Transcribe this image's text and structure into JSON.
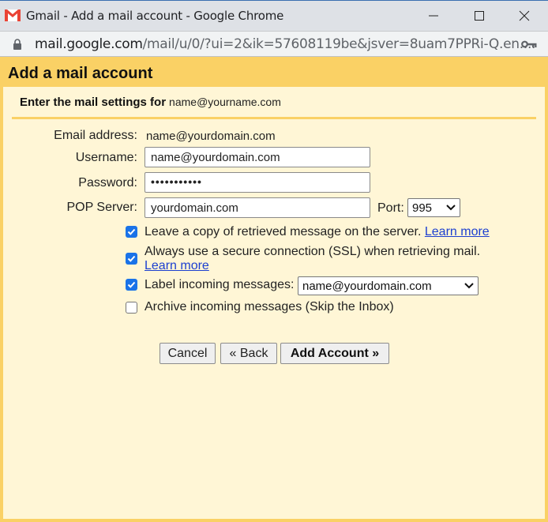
{
  "window": {
    "title": "Gmail - Add a mail account - Google Chrome",
    "app_icon": "gmail-icon",
    "controls": [
      "minimize",
      "maximize",
      "close"
    ]
  },
  "address_bar": {
    "url_host": "mail.google.com",
    "url_path": "/mail/u/0/?ui=2&ik=57608119be&jsver=8uam7PPRi-Q.en....",
    "icons": [
      "lock-icon",
      "key-icon"
    ]
  },
  "dialog": {
    "title": "Add a mail account",
    "subheading_label": "Enter the mail settings for",
    "subheading_email": "name@yourname.com",
    "fields": {
      "email_label": "Email address:",
      "email_value": "name@yourdomain.com",
      "username_label": "Username:",
      "username_value": "name@yourdomain.com",
      "password_label": "Password:",
      "password_value": "•••••••••••",
      "pop_server_label": "POP Server:",
      "pop_server_value": "yourdomain.com",
      "port_label": "Port:",
      "port_value": "995"
    },
    "options": [
      {
        "label": "Leave a copy of retrieved message on the server.",
        "link": "Learn more",
        "checked": true
      },
      {
        "label": "Always use a secure connection (SSL) when retrieving mail.",
        "link": "Learn more",
        "checked": true
      },
      {
        "label": "Label incoming messages:",
        "select_value": "name@yourdomain.com",
        "checked": true
      },
      {
        "label": "Archive incoming messages (Skip the Inbox)",
        "checked": false
      }
    ],
    "buttons": {
      "cancel": "Cancel",
      "back": "« Back",
      "add_account": "Add Account »"
    }
  },
  "colors": {
    "dialog_border": "#fad165",
    "dialog_background": "#fff6d6",
    "checkbox_accent": "#1a73e8",
    "link": "#1c3fd0"
  }
}
